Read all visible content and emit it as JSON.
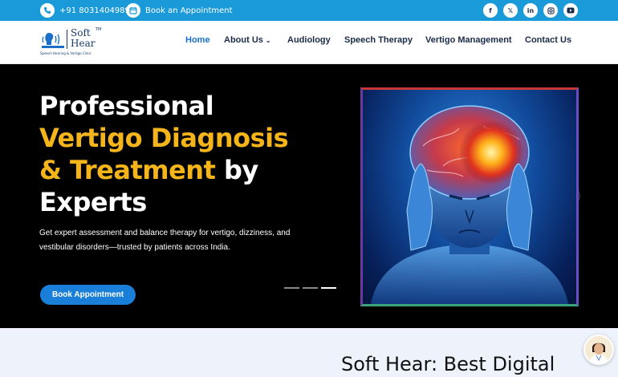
{
  "topbar": {
    "phone": "+91 8031404989",
    "appointment": "Book an Appointment",
    "social": [
      "f",
      "𝕏",
      "in",
      "ig",
      "yt"
    ]
  },
  "logo": {
    "line1": "Soft",
    "line2": "Hear",
    "tm": "TM",
    "tagline": "Speech Hearing & Vertigo Clinic"
  },
  "nav": [
    "Home",
    "About Us",
    "Audiology",
    "Speech Therapy",
    "Vertigo Management",
    "Contact Us"
  ],
  "hero": {
    "line1": "Professional",
    "line2": "Vertigo Diagnosis",
    "line3_yellow": "& Treatment",
    "line3_white": " by",
    "line4": "Experts",
    "sub1": "Get expert assessment and balance therapy for vertigo, dizziness, and",
    "sub2": "vestibular disorders—trusted by patients across India.",
    "button": "Book Appointment"
  },
  "section": {
    "title": "Soft Hear: Best Digital"
  },
  "colors": {
    "topbar": "#1a9ad9",
    "accent_yellow": "#f5b51a",
    "button": "#1a7fd9",
    "nav_active": "#1a6fc9"
  }
}
